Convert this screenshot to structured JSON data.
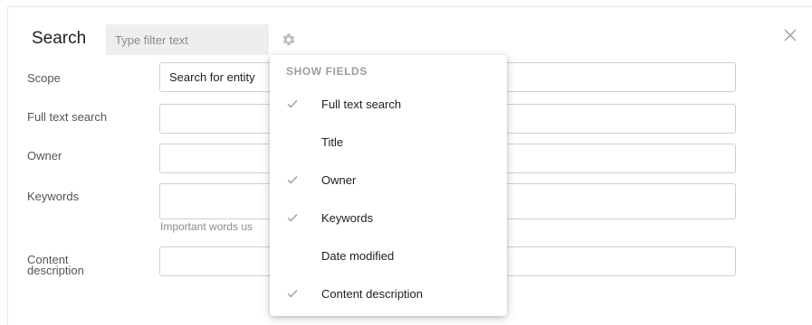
{
  "dialog": {
    "title": "Search",
    "filter_placeholder": "Type filter text"
  },
  "form": {
    "scope_label": "Scope",
    "scope_value": "Search for entity",
    "full_text_label": "Full text search",
    "owner_label": "Owner",
    "keywords_label": "Keywords",
    "keywords_hint": "Important words us",
    "content_description_label": "Content\ndescription"
  },
  "menu": {
    "header": "SHOW FIELDS",
    "items": [
      {
        "label": "Full text search",
        "checked": true
      },
      {
        "label": "Title",
        "checked": false
      },
      {
        "label": "Owner",
        "checked": true
      },
      {
        "label": "Keywords",
        "checked": true
      },
      {
        "label": "Date modified",
        "checked": false
      },
      {
        "label": "Content description",
        "checked": true
      }
    ]
  },
  "icons": {
    "settings": "gear-icon",
    "close": "close-icon",
    "check": "check-icon"
  }
}
